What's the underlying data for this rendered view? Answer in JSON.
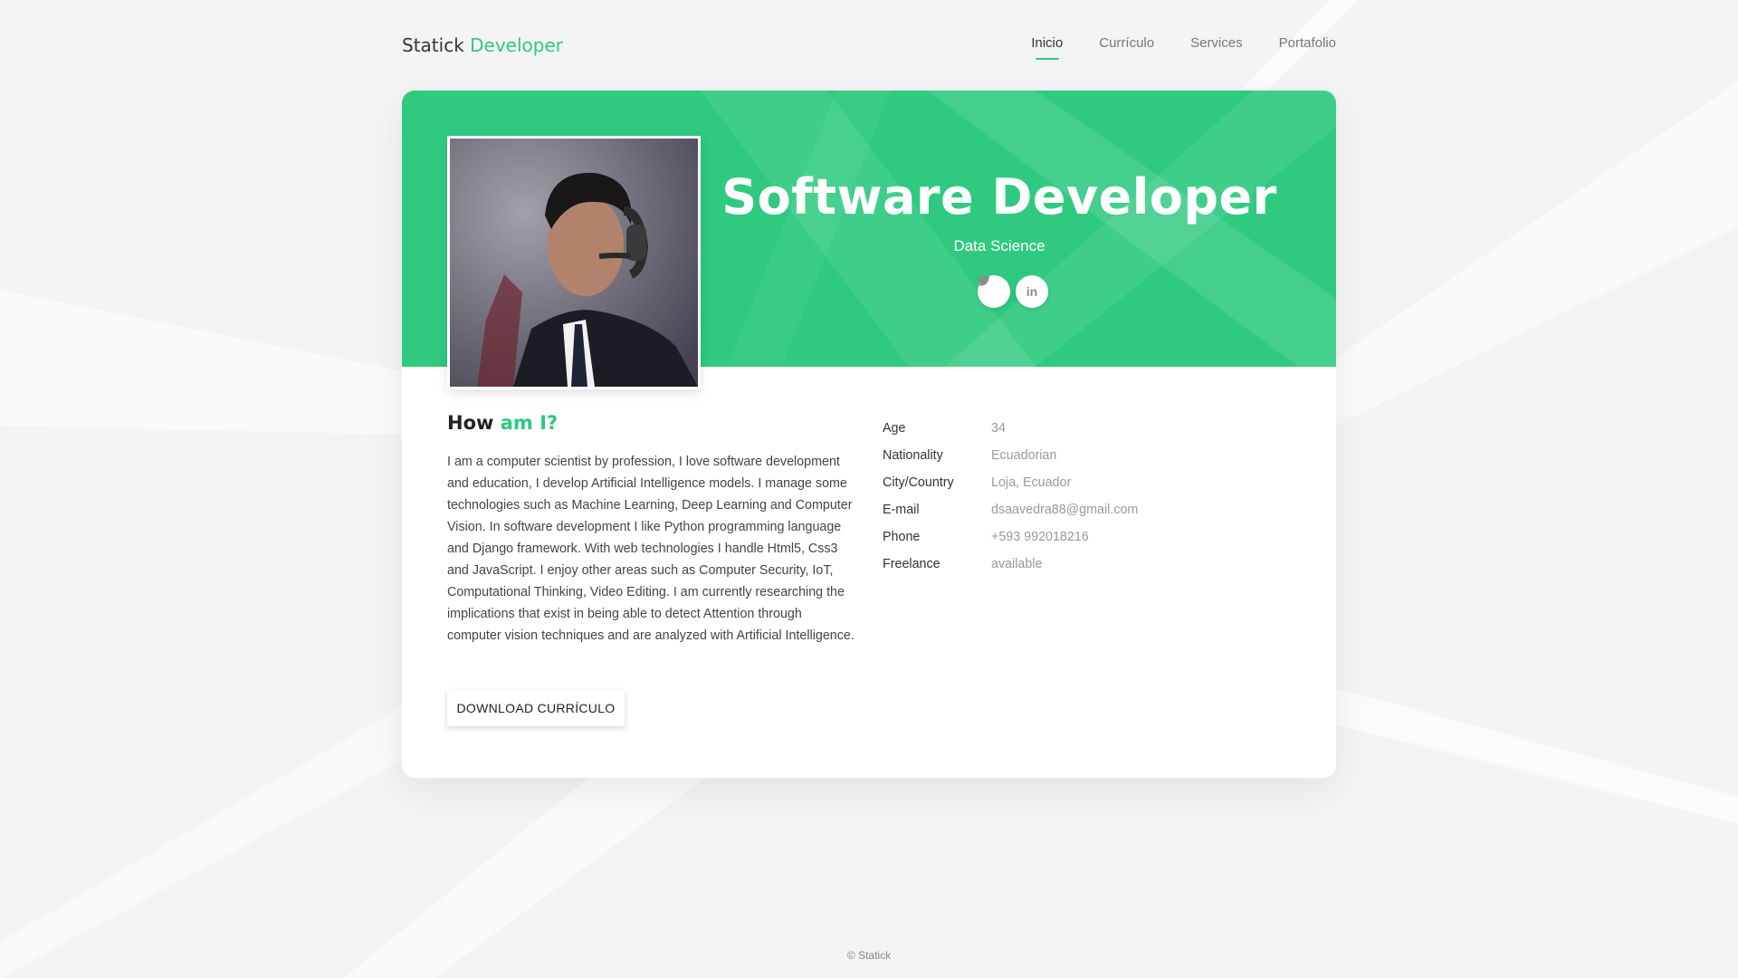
{
  "brand": {
    "name": "Statick",
    "accent": "Developer"
  },
  "nav": {
    "items": [
      {
        "label": "Inicio",
        "active": true
      },
      {
        "label": "Currículo",
        "active": false
      },
      {
        "label": "Services",
        "active": false
      },
      {
        "label": "Portafolio",
        "active": false
      }
    ]
  },
  "hero": {
    "title": "Software Developer",
    "subtitle": "Data Science",
    "social": [
      {
        "icon": "twitter-icon"
      },
      {
        "icon": "linkedin-icon",
        "glyph": "in"
      }
    ]
  },
  "about": {
    "title_main": "How",
    "title_accent": "am I?",
    "text": "I am a computer scientist by profession, I love software development and education, I develop Artificial Intelligence models. I manage some technologies such as Machine Learning, Deep Learning and Computer Vision. In software development I like Python programming language and Django framework. With web technologies I handle Html5, Css3 and JavaScript. I enjoy other areas such as Computer Security, IoT, Computational Thinking, Video Editing. I am currently researching the implications that exist in being able to detect Attention through computer vision techniques and are analyzed with Artificial Intelligence.",
    "button_label": "DOWNLOAD CURRÍCULO"
  },
  "info": [
    {
      "label": "Age",
      "value": "34"
    },
    {
      "label": "Nationality",
      "value": "Ecuadorian"
    },
    {
      "label": "City/Country",
      "value": "Loja, Ecuador"
    },
    {
      "label": "E-mail",
      "value": "dsaavedra88@gmail.com"
    },
    {
      "label": "Phone",
      "value": "+593 992018216"
    },
    {
      "label": "Freelance",
      "value": "available"
    }
  ],
  "footer": {
    "text": "© Statick"
  },
  "colors": {
    "accent": "#2ec97f",
    "hero_bg": "#2fca80",
    "page_bg": "#f4f4f4"
  }
}
